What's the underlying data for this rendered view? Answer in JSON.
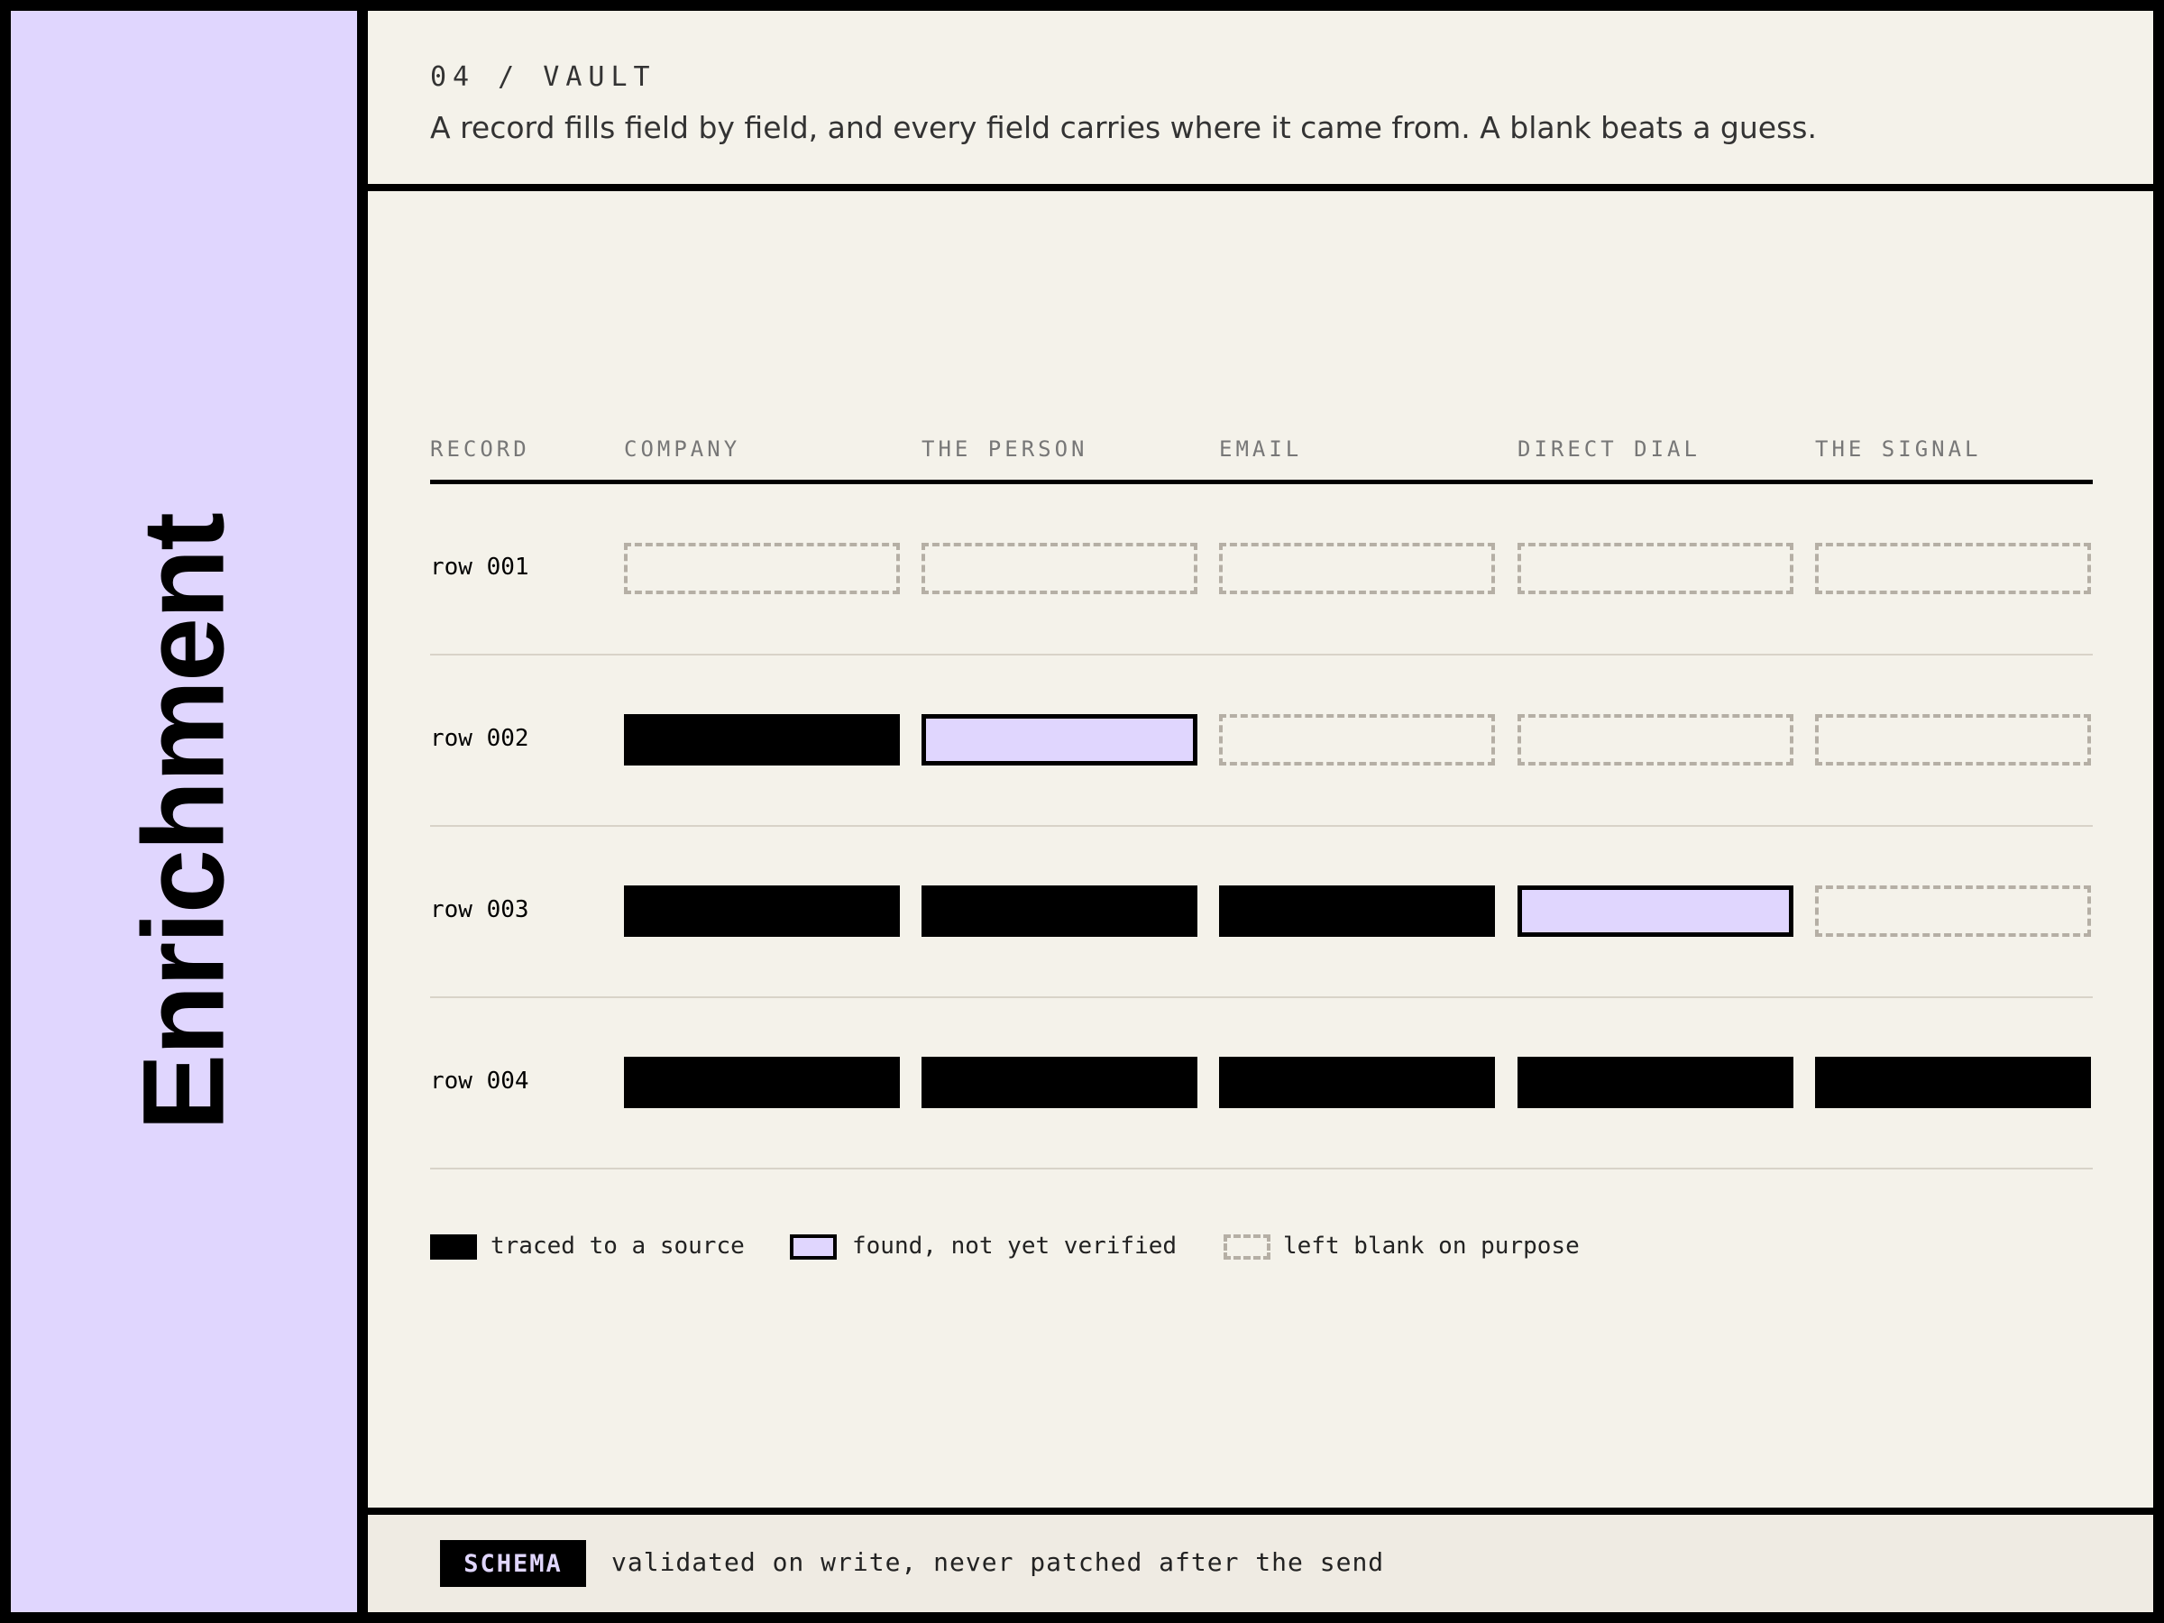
{
  "sidebar": {
    "title": "Enrichment",
    "color": "#e0d6fe"
  },
  "header": {
    "eyebrow": "04 / VAULT",
    "subtitle": "A record fills field by field, and every field carries where it came from. A blank beats a guess."
  },
  "table": {
    "columns": [
      "RECORD",
      "COMPANY",
      "THE PERSON",
      "EMAIL",
      "DIRECT DIAL",
      "THE SIGNAL"
    ],
    "rows": [
      {
        "label": "row 001",
        "states": [
          "blank",
          "blank",
          "blank",
          "blank",
          "blank"
        ]
      },
      {
        "label": "row 002",
        "states": [
          "traced",
          "found",
          "blank",
          "blank",
          "blank"
        ]
      },
      {
        "label": "row 003",
        "states": [
          "traced",
          "traced",
          "traced",
          "found",
          "blank"
        ]
      },
      {
        "label": "row 004",
        "states": [
          "traced",
          "traced",
          "traced",
          "traced",
          "traced"
        ]
      }
    ]
  },
  "legend": [
    {
      "state": "traced",
      "label": "traced to a source"
    },
    {
      "state": "found",
      "label": "found, not yet verified"
    },
    {
      "state": "blank",
      "label": "left blank on purpose"
    }
  ],
  "footer": {
    "tag": "SCHEMA",
    "text": "validated on write, never patched after the send"
  }
}
